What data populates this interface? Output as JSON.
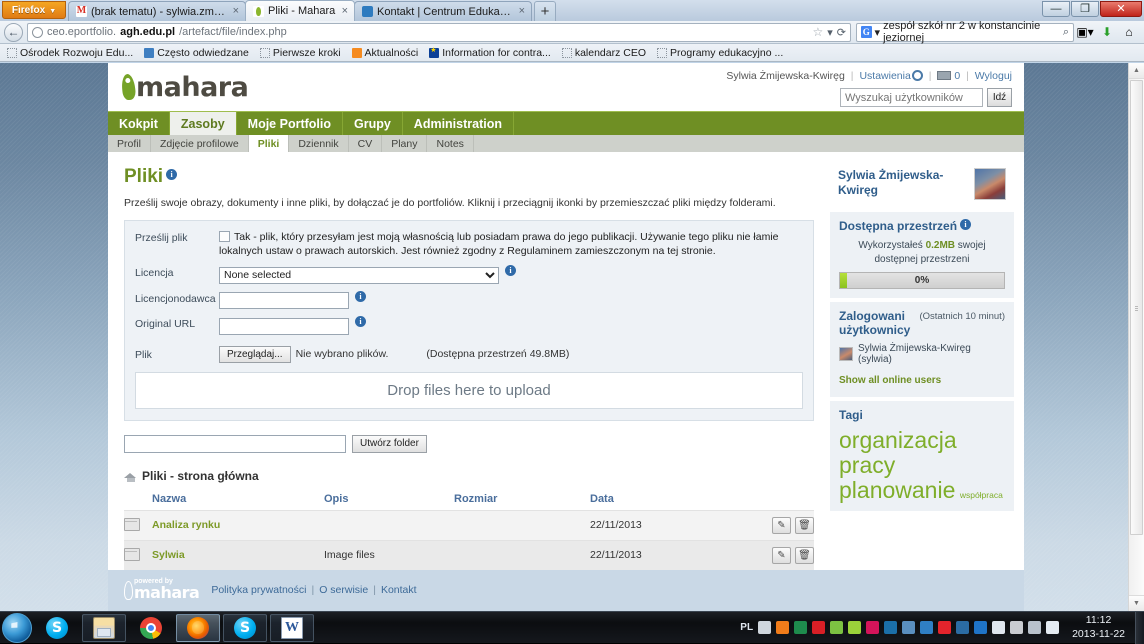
{
  "browser": {
    "firefox_button": "Firefox",
    "tabs": [
      {
        "title": "(brak tematu) - sylwia.zmijewska-kwi...",
        "favicon": "gmail-icon",
        "active": false,
        "closable": true
      },
      {
        "title": "Pliki - Mahara",
        "favicon": "mahara-icon",
        "active": true,
        "closable": true
      },
      {
        "title": "Kontakt | Centrum Edukacji Obywatel...",
        "favicon": "ceo-icon",
        "active": false,
        "closable": true
      }
    ],
    "new_tab_label": "+",
    "window_controls": {
      "minimize": "—",
      "maximize": "❐",
      "close": "✕"
    },
    "url": {
      "prefix": "ceo.eportfolio.",
      "domain": "agh.edu.pl",
      "path": "/artefact/file/index.php"
    },
    "url_star": "☆",
    "url_reload": "⟳",
    "search": {
      "engine": "G",
      "value": "zespół szkół nr 2 w konstancinie jeziornej",
      "magnifier": "🔍"
    },
    "toolbar_icons": [
      "bookmarks-icon",
      "downloads-icon",
      "home-icon"
    ],
    "bookmarks": [
      {
        "label": "Ośrodek Rozwoju Edu...",
        "icon": "generic-bookmark-icon"
      },
      {
        "label": "Często odwiedzane",
        "icon": "blue-bookmark-icon"
      },
      {
        "label": "Pierwsze kroki",
        "icon": "generic-bookmark-icon"
      },
      {
        "label": "Aktualności",
        "icon": "rss-icon"
      },
      {
        "label": "Information for contra...",
        "icon": "eu-flag-icon"
      },
      {
        "label": "kalendarz CEO",
        "icon": "generic-bookmark-icon"
      },
      {
        "label": "Programy edukacyjno ...",
        "icon": "generic-bookmark-icon"
      }
    ]
  },
  "site": {
    "logo_text": "mahara",
    "user_name": "Sylwia Żmijewska-Kwiręg",
    "settings_link": "Ustawienia",
    "messages_count": "0",
    "logout_link": "Wyloguj",
    "search_users": {
      "placeholder": "Wyszukaj użytkowników",
      "value": "",
      "button": "Idź"
    },
    "main_nav": [
      {
        "label": "Kokpit",
        "active": false
      },
      {
        "label": "Zasoby",
        "active": true
      },
      {
        "label": "Moje Portfolio",
        "active": false
      },
      {
        "label": "Grupy",
        "active": false
      },
      {
        "label": "Administration",
        "active": false
      }
    ],
    "sub_nav": [
      {
        "label": "Profil",
        "active": false
      },
      {
        "label": "Zdjęcie profilowe",
        "active": false
      },
      {
        "label": "Pliki",
        "active": true
      },
      {
        "label": "Dziennik",
        "active": false
      },
      {
        "label": "CV",
        "active": false
      },
      {
        "label": "Plany",
        "active": false
      },
      {
        "label": "Notes",
        "active": false
      }
    ]
  },
  "main": {
    "page_title": "Pliki",
    "lead": "Prześlij swoje obrazy, dokumenty i inne pliki, by dołączać je do portfoliów. Kliknij i przeciągnij ikonki by przemieszczać pliki między folderami.",
    "upload": {
      "label_upload": "Prześlij plik",
      "copyright_text": "Tak - plik, który przesyłam jest moją własnością lub posiadam prawa do jego publikacji. Używanie tego pliku nie łamie lokalnych ustaw o prawach autorskich. Jest również zgodny z Regulaminem zamieszczonym na tej stronie.",
      "copyright_checked": false,
      "label_license": "Licencja",
      "license_value": "None selected",
      "license_options": [
        "None selected"
      ],
      "label_licensor": "Licencjonodawca",
      "licensor_value": "",
      "label_original_url": "Original URL",
      "original_url_value": "",
      "label_file": "Plik",
      "browse_button": "Przeglądaj...",
      "no_file_text": "Nie wybrano plików.",
      "quota_note": "(Dostępna przestrzeń 49.8MB)",
      "dropzone_text": "Drop files here to upload"
    },
    "create_folder": {
      "value": "",
      "placeholder": "",
      "button": "Utwórz folder"
    },
    "files_home_title": "Pliki - strona główna",
    "table": {
      "headers": [
        "Nazwa",
        "Opis",
        "Rozmiar",
        "Data"
      ],
      "rows": [
        {
          "name": "Analiza rynku",
          "description": "",
          "size": "",
          "date": "22/11/2013",
          "icon": "folder-icon"
        },
        {
          "name": "Sylwia",
          "description": "Image files",
          "size": "",
          "date": "22/11/2013",
          "icon": "folder-icon"
        }
      ],
      "edit_action": "edit-icon",
      "delete_action": "delete-icon"
    }
  },
  "sidebar": {
    "profile_name": "Sylwia Żmijewska-Kwiręg",
    "quota": {
      "title": "Dostępna przestrzeń",
      "text_before": "Wykorzystałeś",
      "used": "0.2MB",
      "text_after": "swojej dostępnej przestrzeni",
      "percent_label": "0%",
      "percent_value": 0
    },
    "online": {
      "title": "Zalogowani użytkownicy",
      "subtitle": "(Ostatnich 10 minut)",
      "users": [
        "Sylwia Żmijewska-Kwiręg (sylwia)"
      ],
      "show_all": "Show all online users"
    },
    "tags": {
      "title": "Tagi",
      "items": [
        {
          "label": "organizacja pracy",
          "size": "xl"
        },
        {
          "label": "planowanie",
          "size": "xl"
        },
        {
          "label": "współpraca",
          "size": "sm"
        }
      ]
    }
  },
  "footer": {
    "powered_by": "powered by",
    "logo_text": "mahara",
    "links": [
      "Polityka prywatności",
      "O serwisie",
      "Kontakt"
    ]
  },
  "taskbar": {
    "start": "start-orb",
    "items": [
      {
        "icon": "skype-icon",
        "state": "normal"
      },
      {
        "icon": "windows-explorer-icon",
        "state": "boxed"
      },
      {
        "icon": "chrome-icon",
        "state": "normal"
      },
      {
        "icon": "firefox-icon",
        "state": "pressed"
      },
      {
        "icon": "skype-icon",
        "state": "boxed"
      },
      {
        "icon": "word-icon",
        "state": "boxed"
      }
    ],
    "language": "PL",
    "tray_icons": [
      "keyboard-icon",
      "arrow-icon",
      "excel-icon",
      "acrobat-icon",
      "chat-icon",
      "check-icon",
      "kaspersky-icon",
      "camera-icon",
      "printer-icon",
      "update-icon",
      "opera-icon",
      "network-icon",
      "eye-icon",
      "flag-icon",
      "safety-icon",
      "display-icon",
      "volume-icon"
    ],
    "clock_time": "11:12",
    "clock_date": "2013-11-22"
  },
  "colors": {
    "brand_green": "#6f8f24",
    "link_blue": "#3d6a98",
    "heading_blue": "#2f5d8a",
    "tag_green": "#7fae2a",
    "page_bg_top": "#5c7894",
    "page_bg_bottom": "#d2dfea"
  }
}
